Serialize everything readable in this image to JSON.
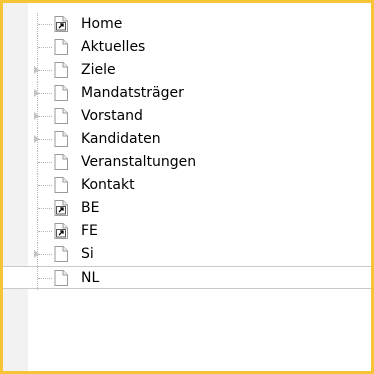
{
  "tree": {
    "items": [
      {
        "label": "Home",
        "icon": "page-shortcut-icon",
        "expandable": false,
        "selected": false
      },
      {
        "label": "Aktuelles",
        "icon": "page-icon",
        "expandable": false,
        "selected": false
      },
      {
        "label": "Ziele",
        "icon": "page-icon",
        "expandable": true,
        "selected": false
      },
      {
        "label": "Mandatsträger",
        "icon": "page-icon",
        "expandable": true,
        "selected": false
      },
      {
        "label": "Vorstand",
        "icon": "page-icon",
        "expandable": true,
        "selected": false
      },
      {
        "label": "Kandidaten",
        "icon": "page-icon",
        "expandable": true,
        "selected": false
      },
      {
        "label": "Veranstaltungen",
        "icon": "page-icon",
        "expandable": false,
        "selected": false
      },
      {
        "label": "Kontakt",
        "icon": "page-icon",
        "expandable": false,
        "selected": false
      },
      {
        "label": "BE",
        "icon": "page-shortcut-icon",
        "expandable": false,
        "selected": false
      },
      {
        "label": "FE",
        "icon": "page-shortcut-icon",
        "expandable": false,
        "selected": false
      },
      {
        "label": "Si",
        "icon": "page-icon",
        "expandable": true,
        "selected": false
      },
      {
        "label": "NL",
        "icon": "page-icon",
        "expandable": false,
        "selected": true
      }
    ]
  },
  "colors": {
    "frame_border": "#f7c435",
    "tree_lines": "#b5b5b5",
    "selected_border": "#c9c9c9"
  }
}
